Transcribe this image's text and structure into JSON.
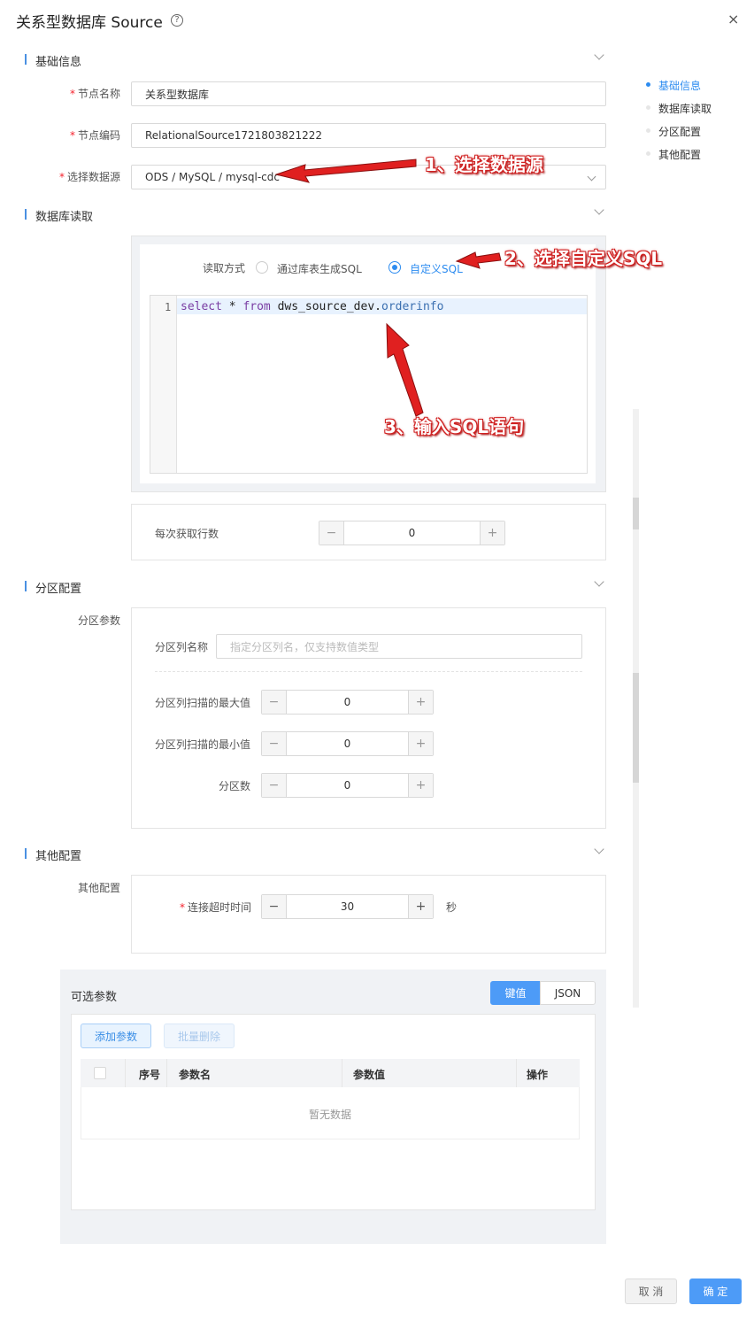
{
  "header": {
    "title": "关系型数据库 Source",
    "help_icon": "?",
    "close_icon": "×"
  },
  "right_nav": {
    "items": [
      {
        "label": "基础信息",
        "active": true
      },
      {
        "label": "数据库读取",
        "active": false
      },
      {
        "label": "分区配置",
        "active": false
      },
      {
        "label": "其他配置",
        "active": false
      }
    ]
  },
  "basic": {
    "section_title": "基础信息",
    "node_name_label": "节点名称",
    "node_name_value": "关系型数据库",
    "node_code_label": "节点编码",
    "node_code_value": "RelationalSource1721803821222",
    "datasource_label": "选择数据源",
    "datasource_value": "ODS / MySQL / mysql-cdc"
  },
  "db_read": {
    "section_title": "数据库读取",
    "read_mode_label": "读取方式",
    "option_table": "通过库表生成SQL",
    "option_custom": "自定义SQL",
    "selected_option": "自定义SQL",
    "line_number": "1",
    "sql": {
      "kw_select": "select",
      "star": " * ",
      "kw_from": "from",
      "table_prefix": " dws_source_dev.",
      "table_name": "orderinfo"
    },
    "fetch_rows_label": "每次获取行数",
    "fetch_rows_value": "0"
  },
  "partition": {
    "section_title": "分区配置",
    "params_label": "分区参数",
    "column_name_label": "分区列名称",
    "column_name_placeholder": "指定分区列名，仅支持数值类型",
    "max_label": "分区列扫描的最大值",
    "max_value": "0",
    "min_label": "分区列扫描的最小值",
    "min_value": "0",
    "count_label": "分区数",
    "count_value": "0"
  },
  "other": {
    "section_title": "其他配置",
    "config_label": "其他配置",
    "timeout_label": "连接超时时间",
    "timeout_value": "30",
    "timeout_unit": "秒"
  },
  "optional_params": {
    "title": "可选参数",
    "tab_kv": "键值",
    "tab_json": "JSON",
    "add_button": "添加参数",
    "batch_delete_button": "批量删除",
    "columns": [
      "序号",
      "参数名",
      "参数值",
      "操作"
    ],
    "empty_text": "暂无数据"
  },
  "stepper": {
    "minus": "−",
    "plus": "+"
  },
  "annotations": {
    "step1": "1、选择数据源",
    "step2": "2、选择自定义SQL",
    "step3": "3、输入SQL语句",
    "arrow_color": "#e02020"
  },
  "footer": {
    "cancel": "取 消",
    "confirm": "确 定"
  },
  "colors": {
    "accent": "#2d8cf0",
    "primary_button": "#4d9bf7",
    "required": "#f5222d"
  }
}
